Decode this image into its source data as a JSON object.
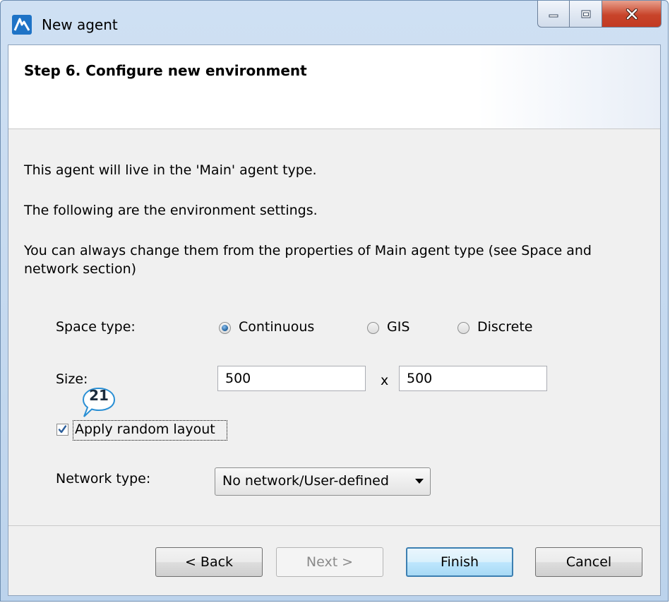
{
  "window": {
    "title": "New agent",
    "controls": [
      "minimize-icon",
      "maximize-icon",
      "close-icon"
    ]
  },
  "header": {
    "step_title": "Step 6. Configure new environment"
  },
  "intro": {
    "line1": "This agent will live in the 'Main' agent type.",
    "line2": "The following are the environment settings.",
    "line3a": "You can always change them from the properties of Main agent type (see Space and",
    "line3b": "network section)"
  },
  "space_type": {
    "label": "Space type:",
    "options": [
      "Continuous",
      "GIS",
      "Discrete"
    ],
    "selected": "Continuous"
  },
  "size": {
    "label": "Size:",
    "width": "500",
    "separator": "x",
    "height": "500"
  },
  "random_layout": {
    "label": "Apply random layout",
    "checked": true,
    "callout_number": "21"
  },
  "network_type": {
    "label": "Network type:",
    "selected": "No network/User-defined"
  },
  "buttons": {
    "back": "< Back",
    "next": "Next >",
    "finish": "Finish",
    "cancel": "Cancel"
  },
  "colors": {
    "accent": "#3c7fb1",
    "callout_border": "#2a8fd4",
    "check": "#2b5e9b"
  }
}
